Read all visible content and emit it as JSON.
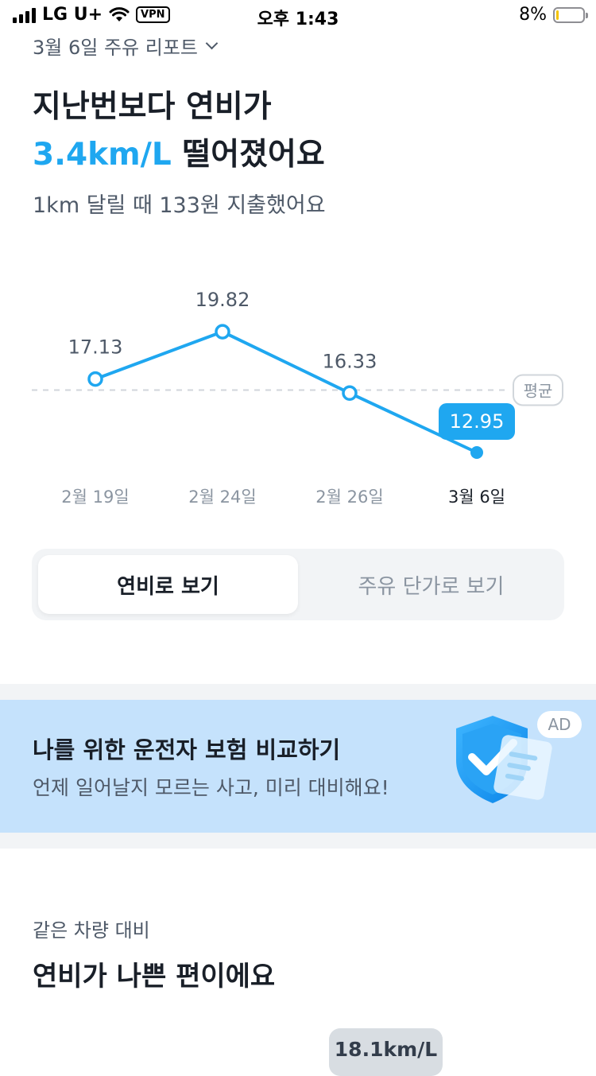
{
  "status_bar": {
    "carrier": "LG U+",
    "vpn": "VPN",
    "time": "오후 1:43",
    "battery": "8%",
    "battery_level": 0.08,
    "battery_color": "#f5c400"
  },
  "header": {
    "report_title": "3월 6일 주유 리포트",
    "dropdown_icon": "chevron-down-icon"
  },
  "headline": {
    "line1": "지난번보다 연비가",
    "accent": "3.4km/L",
    "line2_rest": " 떨어졌어요",
    "subtitle": "1km 달릴 때 133원 지출했어요"
  },
  "colors": {
    "accent": "#1fa7f0",
    "text_primary": "#191f28",
    "text_secondary": "#4e5968",
    "ad_background": "#c5e2fc"
  },
  "chart_data": {
    "type": "line",
    "categories": [
      "2월 19일",
      "2월 24일",
      "2월 26일",
      "3월 6일"
    ],
    "values": [
      17.13,
      19.82,
      16.33,
      12.95
    ],
    "value_labels": [
      "17.13",
      "19.82",
      "16.33",
      "12.95"
    ],
    "selected_index": 3,
    "average_label": "평균",
    "average_value": 16.5,
    "ylim": [
      12.0,
      21.5
    ],
    "grid": false
  },
  "toggle": {
    "options": [
      "연비로 보기",
      "주유 단가로 보기"
    ],
    "selected": 0
  },
  "ad": {
    "title": "나를 위한 운전자 보험 비교하기",
    "description": "언제 일어날지 모르는 사고, 미리 대비해요!",
    "badge": "AD",
    "icon": "shield-check-icon"
  },
  "comparison": {
    "label": "같은 차량 대비",
    "title": "연비가 나쁜 편이에요",
    "value_badge": "18.1km/L"
  }
}
